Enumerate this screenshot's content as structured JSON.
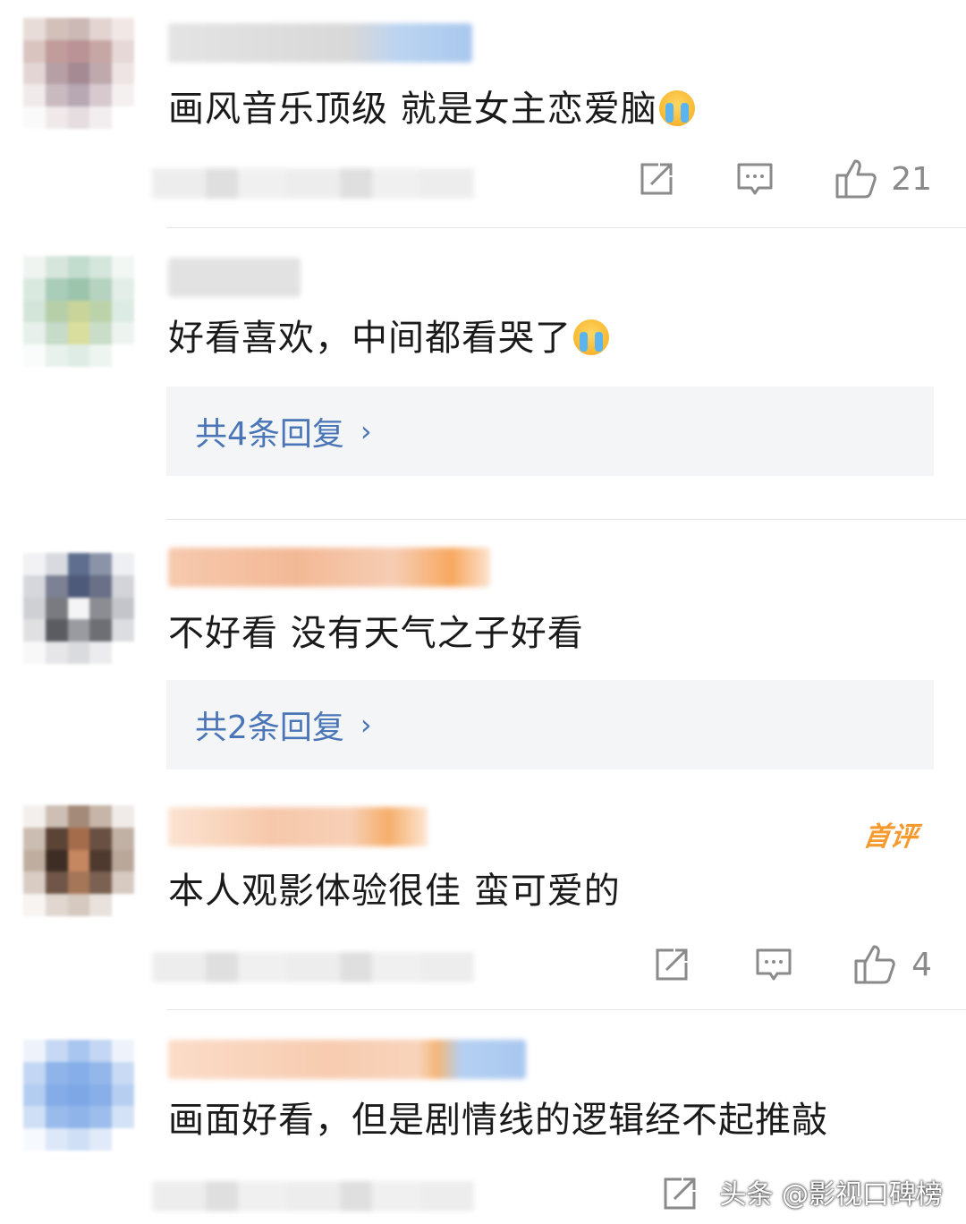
{
  "comments": [
    {
      "text": "画风音乐顶级 就是女主恋爱脑",
      "has_emoji": true,
      "like_count": "21",
      "replies": null
    },
    {
      "text": "好看喜欢，中间都看哭了",
      "has_emoji": true,
      "like_count": null,
      "replies": "共4条回复"
    },
    {
      "text": "不好看 没有天气之子好看",
      "has_emoji": false,
      "like_count": null,
      "replies": "共2条回复"
    },
    {
      "text": "本人观影体验很佳 蛮可爱的",
      "has_emoji": false,
      "badge": "首评",
      "like_count": "4",
      "replies": null
    },
    {
      "text": "画面好看，但是剧情线的逻辑经不起推敲",
      "has_emoji": false,
      "like_count": null,
      "replies": null
    }
  ],
  "icons": {
    "share": "share-icon",
    "comment": "comment-icon",
    "like": "thumbs-up-icon",
    "chevron": "chevron-right-icon",
    "emoji": "crying-face-icon"
  },
  "watermark": "头条 @影视口碑榜",
  "colors": {
    "reply_link": "#4a76b8",
    "badge": "#f59a2e",
    "icon_gray": "#8a8a8a"
  }
}
